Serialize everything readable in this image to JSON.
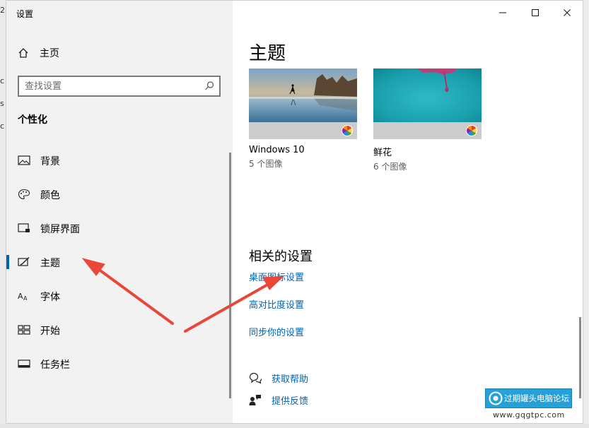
{
  "background_window": {
    "fragments": [
      "2",
      "c",
      "s",
      "c"
    ]
  },
  "window": {
    "title": "设置",
    "controls": {
      "minimize": "minimize",
      "maximize": "maximize",
      "close": "close"
    }
  },
  "sidebar": {
    "home_label": "主页",
    "search_placeholder": "查找设置",
    "section_title": "个性化",
    "items": [
      {
        "label": "背景",
        "icon": "picture-icon"
      },
      {
        "label": "颜色",
        "icon": "palette-icon"
      },
      {
        "label": "锁屏界面",
        "icon": "lock-screen-icon"
      },
      {
        "label": "主题",
        "icon": "theme-brush-icon",
        "active": true
      },
      {
        "label": "字体",
        "icon": "font-icon"
      },
      {
        "label": "开始",
        "icon": "start-grid-icon"
      },
      {
        "label": "任务栏",
        "icon": "taskbar-icon"
      }
    ]
  },
  "content": {
    "title": "主题",
    "themes": [
      {
        "name": "Windows 10",
        "count": "5 个图像"
      },
      {
        "name": "鲜花",
        "count": "6 个图像"
      }
    ],
    "related_title": "相关的设置",
    "related_links": [
      "桌面图标设置",
      "高对比度设置",
      "同步你的设置"
    ],
    "help_label": "获取帮助",
    "feedback_label": "提供反馈"
  },
  "watermark": {
    "text": "过期罐头电脑论坛",
    "url": "www.gqgtpc.com"
  },
  "colors": {
    "accent": "#0063b1",
    "annotation_arrow": "#e8473a",
    "sidebar_bg": "#f2f2f2"
  }
}
